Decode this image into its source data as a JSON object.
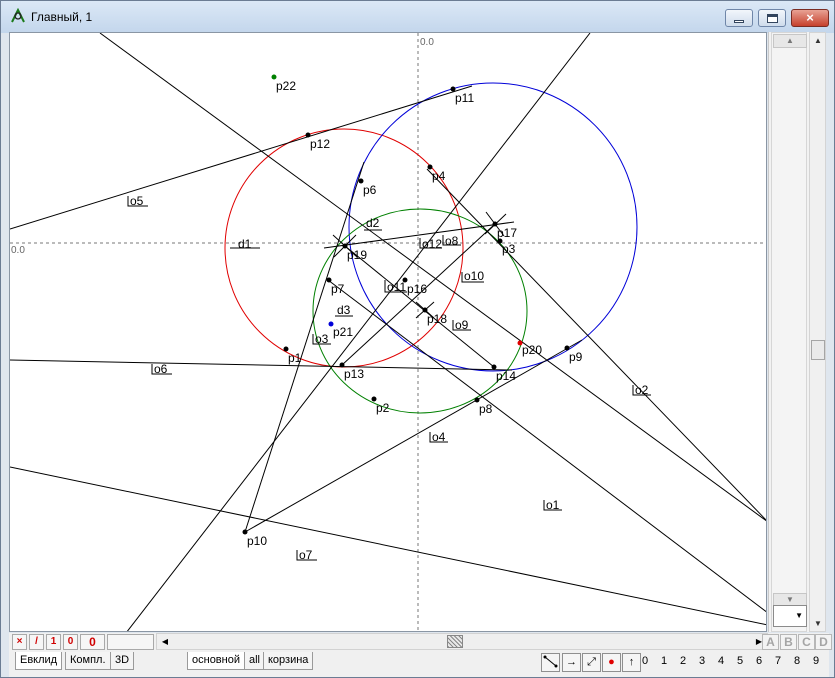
{
  "window": {
    "title": "Главный, 1",
    "controls": {
      "minimize": "minimize-icon",
      "maximize": "maximize-icon",
      "close": "×"
    }
  },
  "canvas": {
    "axis_x_label": "0.0",
    "axis_y_label": "0.0",
    "point_labels": [
      "p1",
      "p2",
      "p3",
      "p4",
      "p6",
      "p7",
      "p8",
      "p9",
      "p10",
      "p11",
      "p12",
      "p13",
      "p14",
      "p16",
      "p17",
      "p18",
      "p19",
      "p20",
      "p21",
      "p22"
    ],
    "object_labels": [
      "o1",
      "o2",
      "o3",
      "o4",
      "o5",
      "o6",
      "o7",
      "o8",
      "o9",
      "o10",
      "o11",
      "o12"
    ],
    "distance_labels": [
      "d1",
      "d2",
      "d3"
    ],
    "colors": {
      "circle_1": "#e00000",
      "circle_2": "#0000d8",
      "circle_3": "#008000",
      "point_p20": "#e00000",
      "point_p21": "#0000d8",
      "point_p22": "#008000"
    }
  },
  "bottom": {
    "mini_buttons": [
      "×",
      "/",
      "1",
      "0"
    ],
    "counter": "0",
    "column_buttons": [
      "A",
      "B",
      "C",
      "D"
    ],
    "tabs_left": [
      "Евклид",
      "Компл.",
      "3D"
    ],
    "tabs_right": [
      "основной",
      "all",
      "корзина"
    ],
    "active_tab": "основной",
    "digits": [
      "0",
      "1",
      "2",
      "3",
      "4",
      "5",
      "6",
      "7",
      "8",
      "9"
    ],
    "tool_icons": [
      "segment-tool-icon",
      "arrow-tool-icon",
      "diagonal-arrow-tool-icon",
      "point-tool-icon",
      "up-arrow-tool-icon"
    ]
  }
}
